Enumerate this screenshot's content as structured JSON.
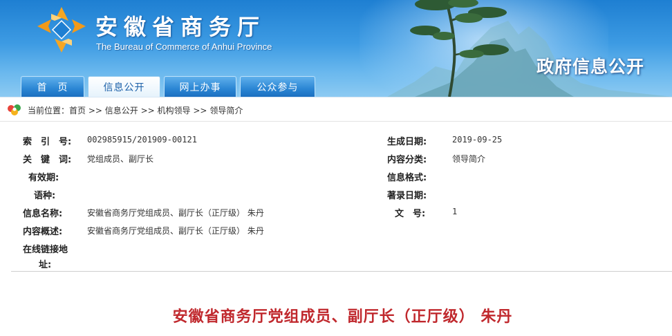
{
  "header": {
    "site_title": "安徽省商务厅",
    "site_subtitle": "The Bureau of Commerce of Anhui Province",
    "section_title": "政府信息公开",
    "accent_color": "#2b86d4"
  },
  "nav": {
    "tabs": [
      {
        "label": "首　页",
        "active": false
      },
      {
        "label": "信息公开",
        "active": true
      },
      {
        "label": "网上办事",
        "active": false
      },
      {
        "label": "公众参与",
        "active": false
      }
    ]
  },
  "breadcrumb": {
    "prefix": "当前位置：",
    "items": [
      "首页",
      "信息公开",
      "机构领导",
      "领导简介"
    ],
    "separator": " >> "
  },
  "info": {
    "index_label": "索　引　号:",
    "index_value": "002985915/201909-00121",
    "date_label": "生成日期:",
    "date_value": "2019-09-25",
    "keyword_label": "关　键　词:",
    "keyword_value": "党组成员、副厅长",
    "category_label": "内容分类:",
    "category_value": "领导简介",
    "validity_label": "有效期:",
    "format_label": "信息格式:",
    "language_label": "语种:",
    "record_date_label": "著录日期:",
    "name_label": "信息名称:",
    "name_value": "安徽省商务厅党组成员、副厅长（正厅级） 朱丹",
    "docno_label": "文　号:",
    "docno_value": "1",
    "summary_label": "内容概述:",
    "summary_value": "安徽省商务厅党组成员、副厅长（正厅级） 朱丹",
    "link_label_line1": "在线链接地",
    "link_label_line2": "址:"
  },
  "document": {
    "title": "安徽省商务厅党组成员、副厅长（正厅级） 朱丹",
    "title_color": "#c0282d"
  }
}
